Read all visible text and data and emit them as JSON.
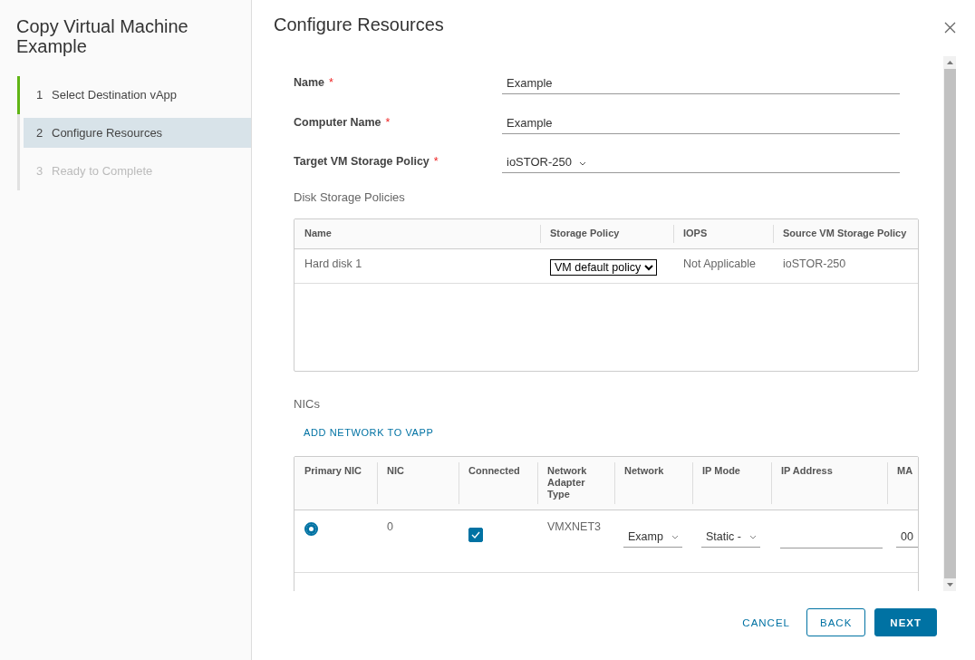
{
  "dialog": {
    "title": "Copy Virtual Machine Example"
  },
  "steps": [
    {
      "number": "1",
      "label": "Select Destination vApp",
      "completed": true,
      "disabled": false,
      "selected": false
    },
    {
      "number": "2",
      "label": "Configure Resources",
      "completed": false,
      "disabled": false,
      "selected": true
    },
    {
      "number": "3",
      "label": "Ready to Complete",
      "completed": false,
      "disabled": true,
      "selected": false
    }
  ],
  "page": {
    "title": "Configure Resources"
  },
  "fields": [
    {
      "label": "Name",
      "required_mark": "*",
      "kind": "text",
      "value": "Example"
    },
    {
      "label": "Computer Name",
      "required_mark": "*",
      "kind": "text",
      "value": "Example"
    },
    {
      "label": "Target VM Storage Policy",
      "required_mark": "*",
      "kind": "dropdown",
      "value": "ioSTOR-250"
    }
  ],
  "disk_policies": {
    "title": "Disk Storage Policies",
    "columns": [
      "Name",
      "Storage Policy",
      "IOPS",
      "Source VM Storage Policy"
    ],
    "rows": [
      {
        "name": "Hard disk 1",
        "storage_policy": "VM default policy",
        "iops": "Not Applicable",
        "source_policy": "ioSTOR-250"
      }
    ]
  },
  "nics": {
    "title": "NICs",
    "add_link": "ADD NETWORK TO VAPP",
    "columns": [
      "Primary NIC",
      "NIC",
      "Connected",
      "Network Adapter Type",
      "Network",
      "IP Mode",
      "IP Address",
      "MA"
    ],
    "rows": [
      {
        "primary": true,
        "nic": "0",
        "connected": true,
        "adapter_type": "VMXNET3",
        "network": "Examp",
        "ip_mode": "Static -",
        "mac": "00"
      }
    ]
  },
  "buttons": [
    {
      "label": "CANCEL",
      "kind": "link"
    },
    {
      "label": "BACK",
      "kind": "outline"
    },
    {
      "label": "NEXT",
      "kind": "primary"
    }
  ]
}
